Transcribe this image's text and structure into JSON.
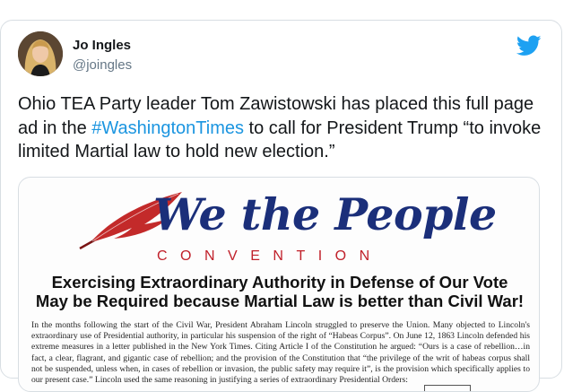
{
  "author": {
    "name": "Jo Ingles",
    "handle": "@joingles"
  },
  "icons": {
    "avatar": "profile-photo",
    "brand": "twitter-bird-icon",
    "brand_color": "#1da1f2",
    "quill": "red-quill-feather-icon"
  },
  "tweet": {
    "text_before": "Ohio TEA Party leader Tom Zawistowski has placed this full page ad in the ",
    "hashtag": "#WashingtonTimes",
    "text_after": " to call for President Trump “to invoke limited Martial law to hold new election.”"
  },
  "ad": {
    "title": "We the People",
    "subtitle": "CONVENTION",
    "headline_line1": "Exercising Extraordinary Authority in Defense of Our Vote",
    "headline_line2": "May be Required because Martial Law is better than Civil War!",
    "body": "In the months following the start of the Civil War, President Abraham Lincoln struggled to preserve the Union. Many objected to Lincoln's extraordinary use of Presidential authority, in particular his suspension of the right of “Habeas Corpus”. On June 12, 1863 Lincoln defended his extreme measures in a letter published in the New York Times. Citing Article I of the Constitution he argued: “Ours is a case of rebellion…in fact, a clear, flagrant, and gigantic case of rebellion; and the provision of the Constitution that “the privilege of the writ of habeas corpus shall not be suspended, unless when, in cases of rebellion or invasion, the public safety may require it”, is the provision which specifically applies to our present case.” Lincoln used the same reasoning in justifying a series of extraordinary Presidential Orders:"
  }
}
